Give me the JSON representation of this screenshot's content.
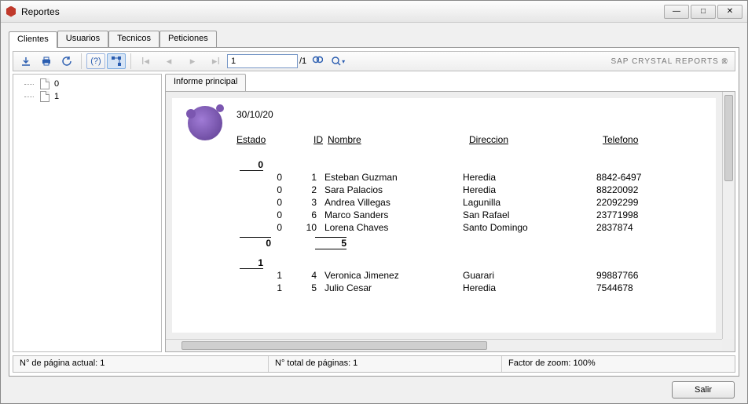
{
  "window": {
    "title": "Reportes"
  },
  "tabs": {
    "clientes": "Clientes",
    "usuarios": "Usuarios",
    "tecnicos": "Tecnicos",
    "peticiones": "Peticiones"
  },
  "toolbar": {
    "page_input": "1",
    "page_sep": "/1",
    "brand": "SAP CRYSTAL REPORTS ®"
  },
  "tree": {
    "item0": "0",
    "item1": "1"
  },
  "subtab": {
    "main": "Informe principal"
  },
  "report": {
    "date": "30/10/20",
    "headers": {
      "estado": "Estado",
      "id": "ID",
      "nombre": "Nombre",
      "direccion": "Direccion",
      "telefono": "Telefono"
    },
    "groups": [
      {
        "label": "0",
        "rows": [
          {
            "estado": "0",
            "id": "1",
            "nombre": "Esteban Guzman",
            "direccion": "Heredia",
            "telefono": "8842-6497"
          },
          {
            "estado": "0",
            "id": "2",
            "nombre": "Sara Palacios",
            "direccion": "Heredia",
            "telefono": "88220092"
          },
          {
            "estado": "0",
            "id": "3",
            "nombre": "Andrea Villegas",
            "direccion": "Lagunilla",
            "telefono": "22092299"
          },
          {
            "estado": "0",
            "id": "6",
            "nombre": "Marco Sanders",
            "direccion": "San Rafael",
            "telefono": "23771998"
          },
          {
            "estado": "0",
            "id": "10",
            "nombre": "Lorena Chaves",
            "direccion": "Santo Domingo",
            "telefono": "2837874"
          }
        ],
        "sum_left": "0",
        "sum_right": "5"
      },
      {
        "label": "1",
        "rows": [
          {
            "estado": "1",
            "id": "4",
            "nombre": "Veronica Jimenez",
            "direccion": "Guarari",
            "telefono": "99887766"
          },
          {
            "estado": "1",
            "id": "5",
            "nombre": "Julio Cesar",
            "direccion": "Heredia",
            "telefono": "7544678"
          }
        ]
      }
    ]
  },
  "status": {
    "current": "N° de página actual: 1",
    "total": "N° total de páginas: 1",
    "zoom": "Factor de zoom: 100%"
  },
  "buttons": {
    "salir": "Salir"
  }
}
